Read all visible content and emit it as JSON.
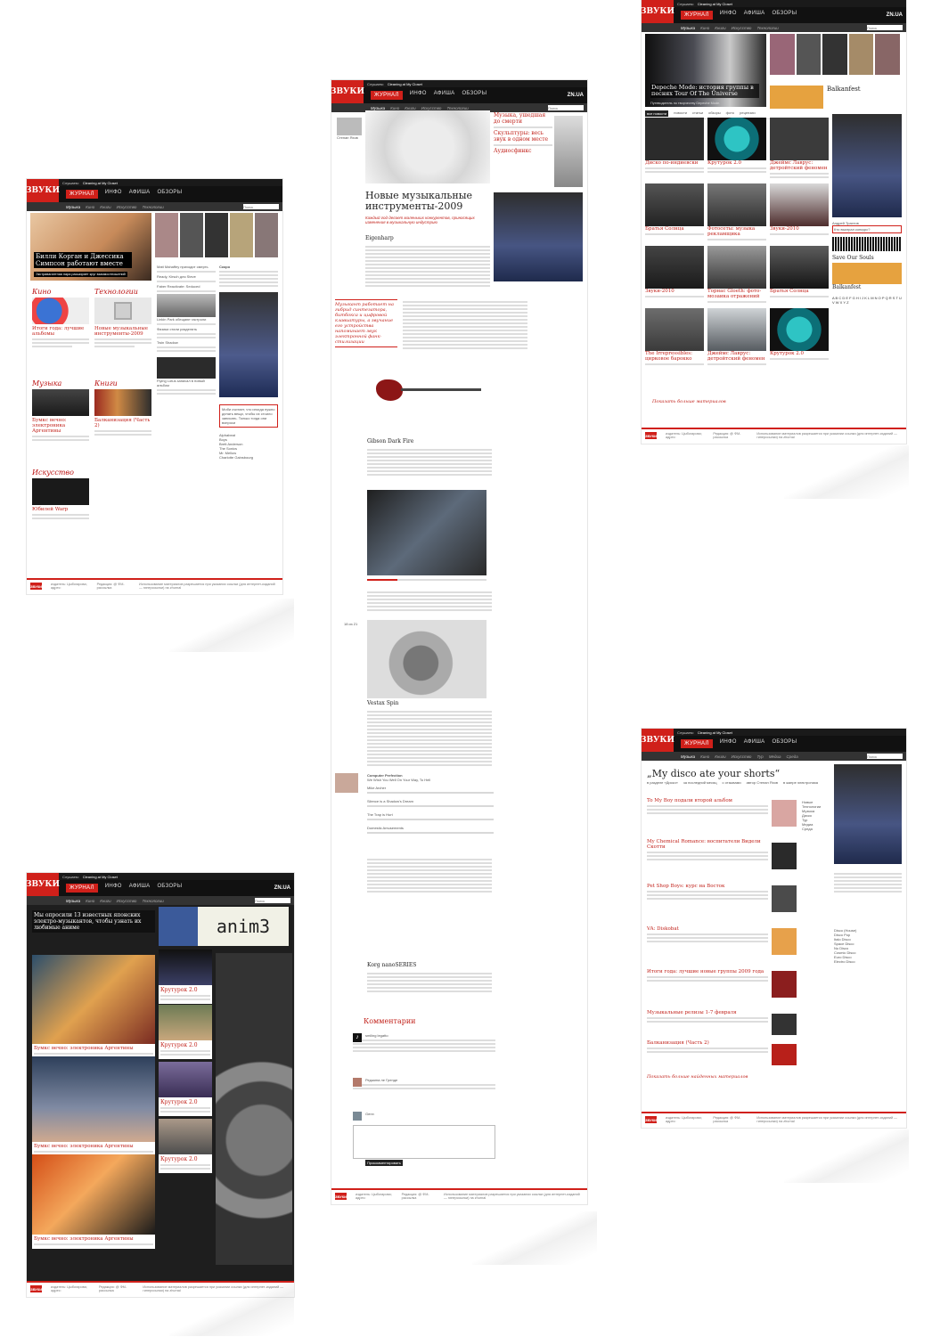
{
  "site": {
    "logo": "ЗВУКИ",
    "nav": [
      "ЖУРНАЛ",
      "ИНФО",
      "АФИША",
      "ОБЗОРЫ"
    ],
    "zn": "ZN.UA",
    "now_playing_label": "Слушаем:",
    "now_playing": "Cleaning at My Closet",
    "search_placeholder": "Поиск",
    "footer_a": "издатель: Цыбогарова; адрес:",
    "footer_b": "Редакция: @ ФМ-рассылка",
    "footer_c": "Использование материалов разрешается при указании ссылки (для интернет-изданий — гиперссылки) на zhurnal"
  },
  "page1": {
    "subnav": [
      "Музыка",
      "Кино",
      "Книги",
      "Искусство",
      "Технологии"
    ],
    "hero_title": "Билли Корган и Джессика Симпсон работают вместе",
    "hero_caption": "Экстравагантная пара расширяет круг взаимоотношений",
    "tabs": [
      "музыка",
      "кино",
      "книги",
      "искусство",
      "технологии"
    ],
    "sections": [
      "Кино",
      "Технологии",
      "Музыка",
      "Книги",
      "Искусство"
    ],
    "kino_title": "Итоги года: лучшие альбомы",
    "tech_title": "Новые музыкальные инструменты-2009",
    "music_title": "Бумкс вечно: электроника Аргентины",
    "books_title": "Балканизация (Часть 2)",
    "art_title": "Юбилей Warp",
    "news": [
      "Matt Mahaffey приходит смерть",
      "Ready, Kirsch для Steve",
      "Faber Reactivate: Seduced",
      "Linkin Park обещают гастроли",
      "Moby",
      "Физики стали разделять",
      "Twin Shadow",
      "Flying Lotus записал в новый альбом"
    ],
    "events_label": "Скоро",
    "moby_quote": "Моби считает, что иногда нужно делать вещи, чтобы их стоило записать. Только тогда они вопроси",
    "playlist": [
      "Alphabeat",
      "Boys",
      "Brett Anderson",
      "The Sonics",
      "Mr. Mellow",
      "Charlotte Gainsbourg"
    ]
  },
  "page2": {
    "subnav": [
      "Музыка",
      "Кино",
      "Книги",
      "Искусство",
      "Технологии"
    ],
    "author": "Степан Яхов",
    "article_title": "Новые музыкальные инструменты-2009",
    "lead": "Каждый год делает маленьких конкурентов, приносящих изменения в музыкальную индустрию",
    "quote": "Музыкант работает на гибрид синтезатора, битбокса и цифровой клавиатуры, а звучание его устройства напоминает звук электронной фанк-стилизации",
    "sections": [
      "Eigenharp",
      "Gibson Dark Fire",
      "Vestax Spin",
      "Korg nanoSERIES"
    ],
    "side_items": [
      "Музыка, ушедшая до смерти",
      "Скульптуры: весь звук в одном месте",
      "Аудиосфинкс"
    ],
    "player_title": "Computer Perfection",
    "player_sub": "We Wish You Well On Your Way, To Hell",
    "tracks": [
      "Mike Archer",
      "Silence is a Shadow's Dream",
      "The Trap is Hurt",
      "Domestic Amusements"
    ],
    "comments_title": "Комментарии",
    "commenters": [
      "smiling legatto",
      "Реджина ле Гренде",
      "Genn"
    ],
    "submit_label": "Прокомментировать",
    "pager": "18 из 21"
  },
  "page3": {
    "subnav": [
      "Музыка",
      "Кино",
      "Книги",
      "Искусство",
      "Технологии"
    ],
    "banner_title": "anim3",
    "intro": "Мы опросили 13 известных японских электро-музыкантов, чтобы узнать их любимые аниме",
    "tiles": [
      "Бумкс вечно: электроника Аргентины",
      "Бумкс вечно: электроника Аргентины",
      "Бумкс вечно: электроника Аргентины",
      "Бумкс вечно: электроника Аргентины"
    ],
    "side_tiles": [
      "Крутурок 2.0",
      "Крутурок 2.0",
      "Крутурок 2.0",
      "Крутурок 2.0"
    ]
  },
  "page4": {
    "subnav": [
      "Музыка",
      "Кино",
      "Книги",
      "Искусство",
      "Технологии"
    ],
    "hero_title": "Depeche Mode: история группы в песнях Tour Of The Universe",
    "hero_caption": "Путеводитель по творчеству Depeche Mode.",
    "side_title": "Balkanfest",
    "tabs": [
      "все новости",
      "новости",
      "статьи",
      "обзоры",
      "фото",
      "рецензии"
    ],
    "grid": [
      "Диско по-индиевски",
      "Крутурок 2.0",
      "Джеймс Лаврус: детройтский феномен",
      "Братья Солнца",
      "Фотосеты: музыка рекламщика",
      "Звуки-2010",
      "Звуки-2010",
      "Тоpнас Gloeth: фото-мозаика отражений",
      "Братья Солнца",
      "The Irrepressibles: цирковое барокко",
      "Джеймс Лаврус: детройтский феномен",
      "Крутурок 2.0"
    ],
    "more": "Показать больше материалов",
    "aside": [
      "Андрей Трахтов",
      "Кто выиграл конкурс?",
      "Save Our Souls",
      "Balkanfest"
    ]
  },
  "page5": {
    "subnav": [
      "Музыка",
      "Кино",
      "Книги",
      "Искусство",
      "Тур",
      "Медиа",
      "Среда"
    ],
    "title": "„My disco ate your shorts“",
    "meta": [
      "в разделе «Диско»",
      "за последний месяц",
      "с отзывами",
      "автор Степан Яхов",
      "в жанре электроника"
    ],
    "items": [
      "To My Boy подали второй альбом",
      "My Chemical Romance: воспитатели Видели Скотти",
      "Pet Shop Boys: курс на Восток",
      "VA: Diskobat",
      "Итоги года: лучшие новые группы 2009 года",
      "Музыкальные релизы 1-7 февраля",
      "Балканизация (Часть 2)"
    ],
    "filters": [
      "Новые",
      "Технологии",
      "Музыка",
      "Диско",
      "Тур",
      "Медиа",
      "Среда"
    ],
    "right_list": [
      "Disco (House)",
      "Disco Pop",
      "Italo Disco",
      "Space Disco",
      "Nu Disco",
      "Cosmic Disco",
      "Euro Disco",
      "Electro Disco"
    ],
    "more": "Показать больше найденных материалов"
  }
}
